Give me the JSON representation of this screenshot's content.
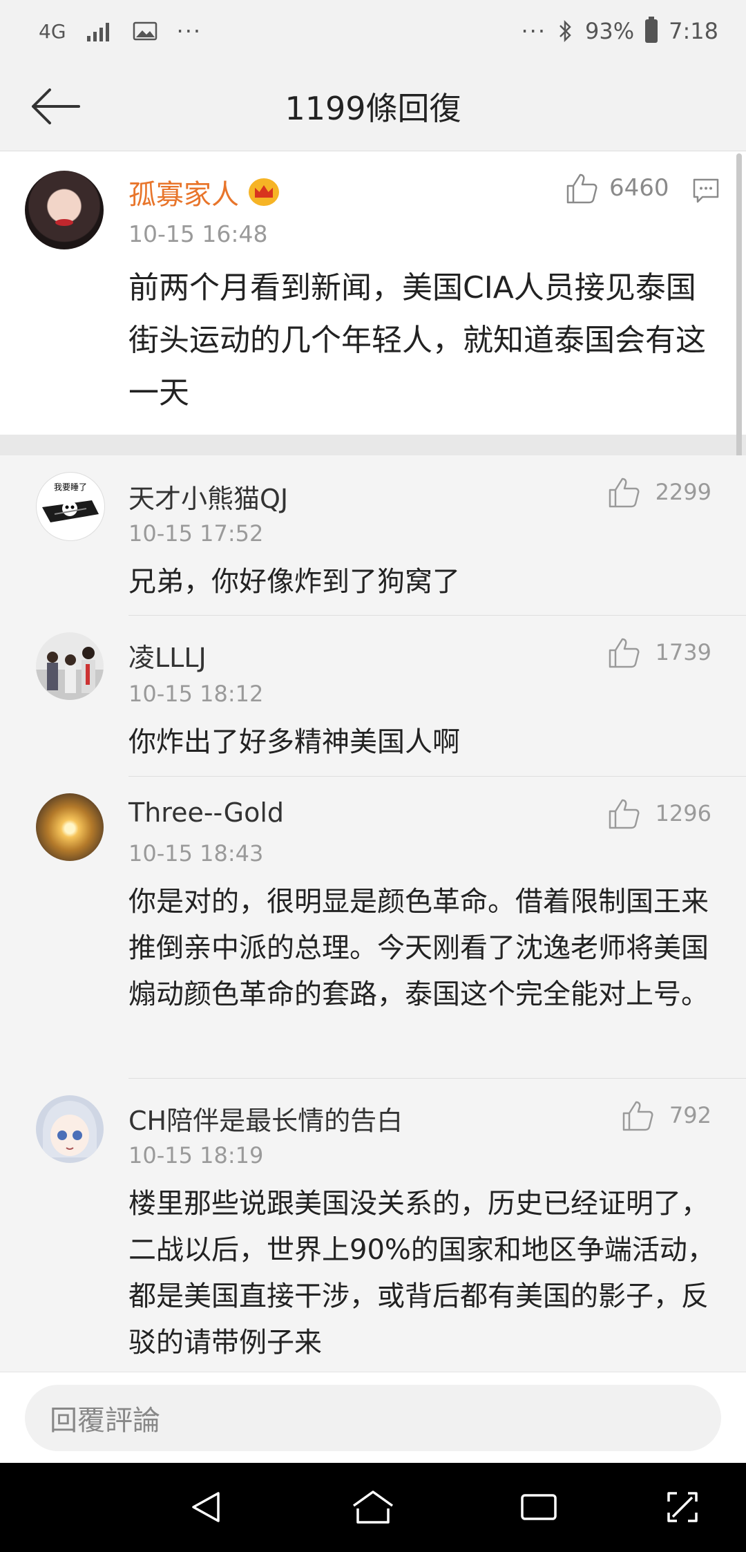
{
  "status_bar": {
    "network": "4G",
    "left_dots": "···",
    "right_dots": "···",
    "battery": "93%",
    "time": "7:18"
  },
  "header": {
    "title": "1199條回復"
  },
  "main_comment": {
    "username": "孤寡家人",
    "time": "10-15 16:48",
    "likes": "6460",
    "text": "前两个月看到新闻，美国CIA人员接见泰国街头运动的几个年轻人，就知道泰国会有这一天"
  },
  "replies": [
    {
      "username": "天才小熊猫QJ",
      "time": "10-15 17:52",
      "likes": "2299",
      "text": "兄弟，你好像炸到了狗窝了",
      "avatar_caption": "我要睡了"
    },
    {
      "username": "凌LLLJ",
      "time": "10-15 18:12",
      "likes": "1739",
      "text": "你炸出了好多精神美国人啊"
    },
    {
      "username": "Three--Gold",
      "time": "10-15 18:43",
      "likes": "1296",
      "text": "你是对的，很明显是颜色革命。借着限制国王来推倒亲中派的总理。今天刚看了沈逸老师将美国煽动颜色革命的套路，泰国这个完全能对上号。"
    },
    {
      "username": "CH陪伴是最长情的告白",
      "time": "10-15 18:19",
      "likes": "792",
      "text": "楼里那些说跟美国没关系的，历史已经证明了，二战以后，世界上90%的国家和地区争端活动，都是美国直接干涉，或背后都有美国的影子，反驳的请带例子来"
    }
  ],
  "input_bar": {
    "placeholder": "回覆評論"
  },
  "colors": {
    "username_accent": "#e8752b",
    "background": "#f2f2f2"
  }
}
